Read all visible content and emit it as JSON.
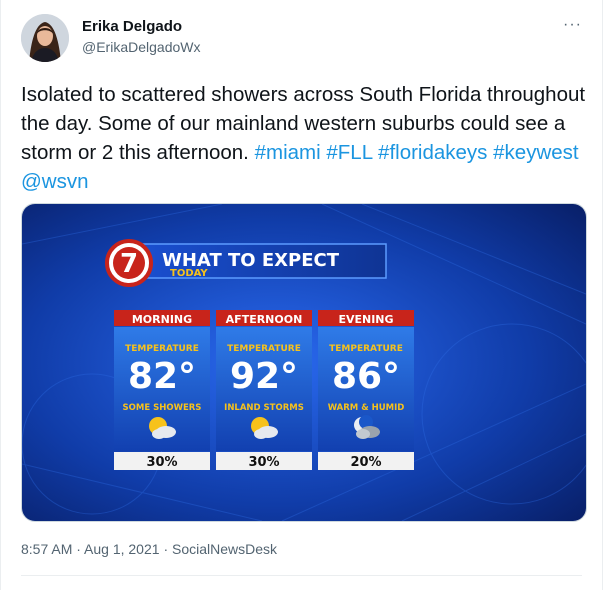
{
  "author": {
    "display_name": "Erika Delgado",
    "handle": "@ErikaDelgadoWx"
  },
  "tweet": {
    "text_plain": "Isolated to scattered showers across South Florida throughout the day.  Some of our mainland western suburbs could see a storm or 2 this afternoon.",
    "hashtags": [
      "#miami",
      "#FLL",
      "#floridakeys",
      "#keywest"
    ],
    "mention": "@wsvn",
    "timestamp": "8:57 AM · Aug 1, 2021",
    "source": "SocialNewsDesk"
  },
  "graphic": {
    "logo_number": "7",
    "title": "WHAT TO EXPECT",
    "subtitle": "TODAY",
    "columns": [
      {
        "period": "MORNING",
        "label": "TEMPERATURE",
        "temp": "82°",
        "condition": "SOME SHOWERS",
        "icon": "sun-cloud-rain-icon",
        "chance": "30%"
      },
      {
        "period": "AFTERNOON",
        "label": "TEMPERATURE",
        "temp": "92°",
        "condition": "INLAND STORMS",
        "icon": "sun-cloud-storm-icon",
        "chance": "30%"
      },
      {
        "period": "EVENING",
        "label": "TEMPERATURE",
        "temp": "86°",
        "condition": "WARM & HUMID",
        "icon": "moon-cloud-icon",
        "chance": "20%"
      }
    ]
  },
  "colors": {
    "link": "#1b95e0",
    "header_red": "#c8241b",
    "panel_blue": "#1a57c9",
    "label_yellow": "#f7c21b"
  }
}
